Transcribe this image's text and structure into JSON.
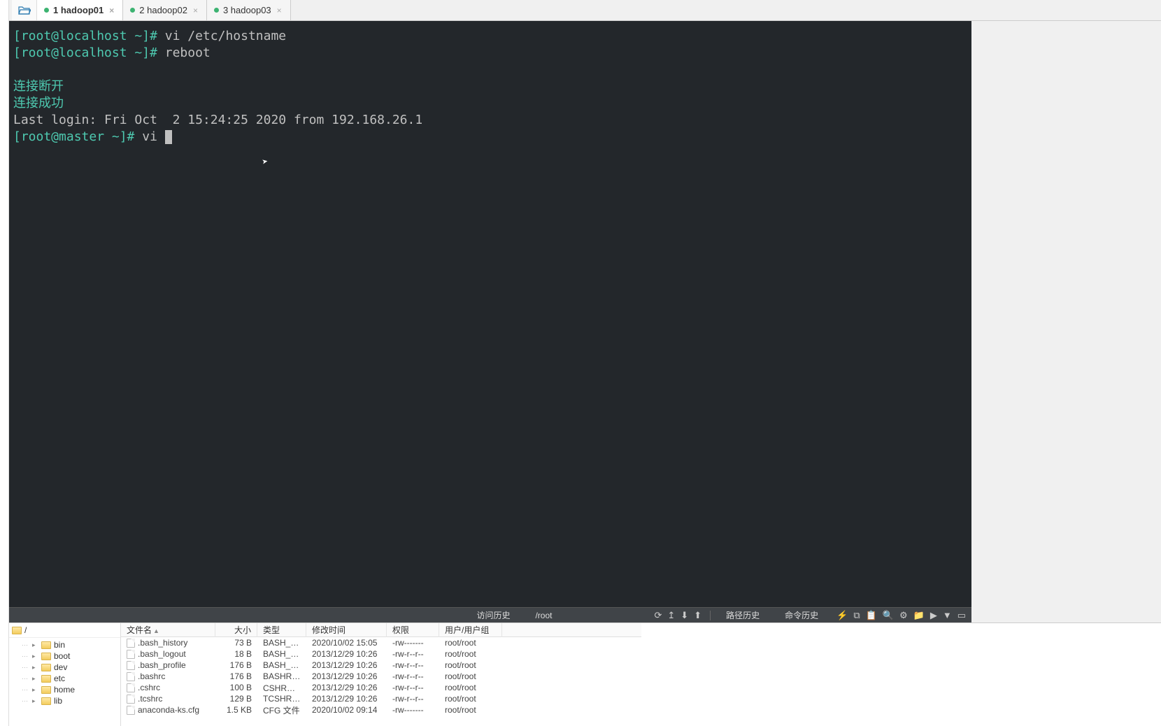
{
  "tabs": [
    {
      "label": "1 hadoop01",
      "active": true
    },
    {
      "label": "2 hadoop02",
      "active": false
    },
    {
      "label": "3 hadoop03",
      "active": false
    }
  ],
  "terminal": {
    "line1_prompt": "[root@localhost ~]#",
    "line1_cmd": " vi /etc/hostname",
    "line2_prompt": "[root@localhost ~]#",
    "line2_cmd": " reboot",
    "disconnect": "连接断开",
    "connected": "连接成功",
    "last_login": "Last login: Fri Oct  2 15:24:25 2020 from 192.168.26.1",
    "cur_prompt": "[root@master ~]#",
    "cur_cmd": " vi "
  },
  "footer": {
    "history_label": "访问历史",
    "path": "/root",
    "path_history": "路径历史",
    "cmd_history": "命令历史"
  },
  "tree": {
    "root": "/",
    "items": [
      "bin",
      "boot",
      "dev",
      "etc",
      "home",
      "lib"
    ]
  },
  "list": {
    "headers": {
      "name": "文件名",
      "size": "大小",
      "type": "类型",
      "date": "修改时间",
      "perm": "权限",
      "owner": "用户/用户组"
    },
    "rows": [
      {
        "name": ".bash_history",
        "size": "73 B",
        "type": "BASH_HIS...",
        "date": "2020/10/02 15:05",
        "perm": "-rw-------",
        "owner": "root/root"
      },
      {
        "name": ".bash_logout",
        "size": "18 B",
        "type": "BASH_LO...",
        "date": "2013/12/29 10:26",
        "perm": "-rw-r--r--",
        "owner": "root/root"
      },
      {
        "name": ".bash_profile",
        "size": "176 B",
        "type": "BASH_PR...",
        "date": "2013/12/29 10:26",
        "perm": "-rw-r--r--",
        "owner": "root/root"
      },
      {
        "name": ".bashrc",
        "size": "176 B",
        "type": "BASHRC ...",
        "date": "2013/12/29 10:26",
        "perm": "-rw-r--r--",
        "owner": "root/root"
      },
      {
        "name": ".cshrc",
        "size": "100 B",
        "type": "CSHRC 文件",
        "date": "2013/12/29 10:26",
        "perm": "-rw-r--r--",
        "owner": "root/root"
      },
      {
        "name": ".tcshrc",
        "size": "129 B",
        "type": "TCSHRC ...",
        "date": "2013/12/29 10:26",
        "perm": "-rw-r--r--",
        "owner": "root/root"
      },
      {
        "name": "anaconda-ks.cfg",
        "size": "1.5 KB",
        "type": "CFG 文件",
        "date": "2020/10/02 09:14",
        "perm": "-rw-------",
        "owner": "root/root"
      }
    ]
  }
}
